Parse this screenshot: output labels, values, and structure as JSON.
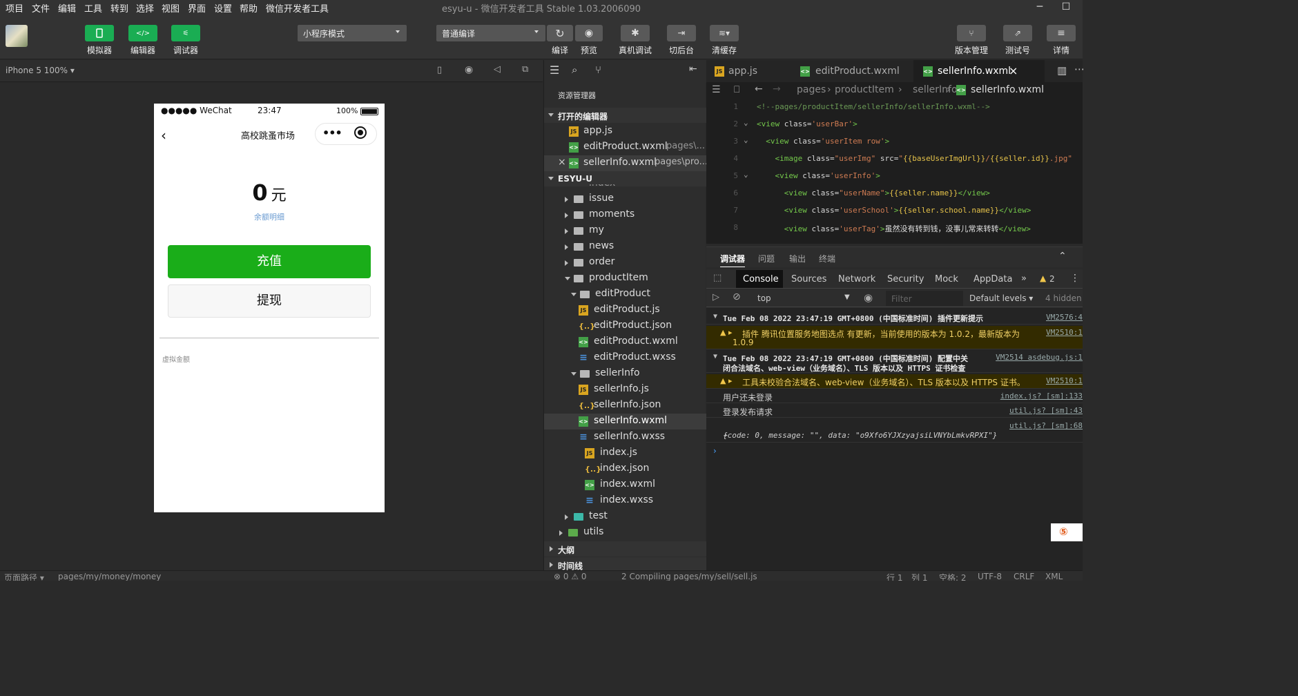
{
  "menu": [
    "项目",
    "文件",
    "编辑",
    "工具",
    "转到",
    "选择",
    "视图",
    "界面",
    "设置",
    "帮助",
    "微信开发者工具"
  ],
  "window_title": "esyu-u - 微信开发者工具 Stable 1.03.2006090",
  "toolbar": {
    "simulator": "模拟器",
    "editor": "编辑器",
    "debugger": "调试器",
    "mode_select": "小程序模式",
    "compile_select": "普通编译",
    "compile": "编译",
    "preview": "预览",
    "real_debug": "真机调试",
    "switch_bg": "切后台",
    "clear_cache": "清缓存",
    "version": "版本管理",
    "test_account": "测试号",
    "details": "详情"
  },
  "sim": {
    "device": "iPhone 5 100% ▾",
    "status_carrier": "●●●●● WeChat",
    "status_time": "23:47",
    "status_battery": "100%",
    "nav_title": "高校跳蚤市场",
    "balance_value": "0",
    "balance_unit": "元",
    "balance_link": "余额明细",
    "recharge_btn": "充值",
    "withdraw_btn": "提现",
    "virtual_amount": "虚拟金额"
  },
  "explorer": {
    "title": "资源管理器",
    "open_editors": "打开的编辑器",
    "open_files": [
      {
        "name": "app.js",
        "path": "",
        "type": "js"
      },
      {
        "name": "editProduct.wxml",
        "path": "pages\\...",
        "type": "wxml"
      },
      {
        "name": "sellerInfo.wxml",
        "path": "pages\\pro...",
        "type": "wxml"
      }
    ],
    "project": "ESYU-U",
    "partial": "index",
    "outline": "大纲",
    "timeline": "时间线"
  },
  "tree": [
    {
      "name": "issue",
      "type": "folder",
      "depth": 0,
      "exp": "r"
    },
    {
      "name": "moments",
      "type": "folder",
      "depth": 0,
      "exp": "r"
    },
    {
      "name": "my",
      "type": "folder",
      "depth": 0,
      "exp": "r"
    },
    {
      "name": "news",
      "type": "folder",
      "depth": 0,
      "exp": "r"
    },
    {
      "name": "order",
      "type": "folder",
      "depth": 0,
      "exp": "r"
    },
    {
      "name": "productItem",
      "type": "folder",
      "depth": 0,
      "exp": "d"
    },
    {
      "name": "editProduct",
      "type": "folder",
      "depth": 1,
      "exp": "d"
    },
    {
      "name": "editProduct.js",
      "type": "js",
      "depth": 2
    },
    {
      "name": "editProduct.json",
      "type": "json",
      "depth": 2
    },
    {
      "name": "editProduct.wxml",
      "type": "wxml",
      "depth": 2
    },
    {
      "name": "editProduct.wxss",
      "type": "wxss",
      "depth": 2
    },
    {
      "name": "sellerInfo",
      "type": "folder",
      "depth": 1,
      "exp": "d"
    },
    {
      "name": "sellerInfo.js",
      "type": "js",
      "depth": 2
    },
    {
      "name": "sellerInfo.json",
      "type": "json",
      "depth": 2
    },
    {
      "name": "sellerInfo.wxml",
      "type": "wxml",
      "depth": 2,
      "sel": true
    },
    {
      "name": "sellerInfo.wxss",
      "type": "wxss",
      "depth": 2
    },
    {
      "name": "index.js",
      "type": "js",
      "depth": 1
    },
    {
      "name": "index.json",
      "type": "json",
      "depth": 1
    },
    {
      "name": "index.wxml",
      "type": "wxml",
      "depth": 1
    },
    {
      "name": "index.wxss",
      "type": "wxss",
      "depth": 1
    },
    {
      "name": "test",
      "type": "folder-teal",
      "depth": 0,
      "exp": "r"
    },
    {
      "name": "utils",
      "type": "folder-green",
      "depth": -1,
      "exp": "r"
    }
  ],
  "editor": {
    "tabs": [
      "app.js",
      "editProduct.wxml",
      "sellerInfo.wxml"
    ],
    "breadcrumb": [
      "pages",
      "productItem",
      "sellerInfo",
      "sellerInfo.wxml"
    ],
    "lines": [
      {
        "n": "1",
        "html": "<span class='cm'>&lt;!--pages/productItem/sellerInfo/sellerInfo.wxml--&gt;</span>"
      },
      {
        "n": "2",
        "html": "<span class='tg'>&lt;view</span> <span class='at'>class=</span><span class='sv'>'userBar'</span><span class='tg'>&gt;</span>"
      },
      {
        "n": "3",
        "html": "&nbsp;&nbsp;<span class='tg'>&lt;view</span> <span class='at'>class=</span><span class='sv'>'userItem row'</span><span class='tg'>&gt;</span>"
      },
      {
        "n": "4",
        "html": "&nbsp;&nbsp;&nbsp;&nbsp;<span class='tg'>&lt;image</span> <span class='at'>class=</span><span class='sv'>\"userImg\"</span> <span class='at'>src=</span><span class='sv'>\"</span><span class='ex'>{{baseUserImgUrl}}</span><span class='sv'>/</span><span class='ex'>{{seller.id}}</span><span class='sv'>.jpg\"</span>"
      },
      {
        "n": "5",
        "html": "&nbsp;&nbsp;&nbsp;&nbsp;<span class='tg'>&lt;view</span> <span class='at'>class=</span><span class='sv'>'userInfo'</span><span class='tg'>&gt;</span>"
      },
      {
        "n": "6",
        "html": "&nbsp;&nbsp;&nbsp;&nbsp;&nbsp;&nbsp;<span class='tg'>&lt;view</span> <span class='at'>class=</span><span class='sv'>\"userName\"</span><span class='tg'>&gt;</span><span class='ex'>{{seller.name}}</span><span class='tg'>&lt;/view&gt;</span>"
      },
      {
        "n": "7",
        "html": "&nbsp;&nbsp;&nbsp;&nbsp;&nbsp;&nbsp;<span class='tg'>&lt;view</span> <span class='at'>class=</span><span class='sv'>'userSchool'</span><span class='tg'>&gt;</span><span class='ex'>{{seller.school.name}}</span><span class='tg'>&lt;/view&gt;</span>"
      },
      {
        "n": "8",
        "html": "&nbsp;&nbsp;&nbsp;&nbsp;&nbsp;&nbsp;<span class='tg'>&lt;view</span> <span class='at'>class=</span><span class='sv'>'userTag'</span><span class='tg'>&gt;</span>虽然没有转到钱，没事儿常来转转<span class='tg'>&lt;/view&gt;</span>"
      }
    ]
  },
  "devtools": {
    "tabs": [
      "调试器",
      "问题",
      "输出",
      "终端"
    ],
    "panels": [
      "Console",
      "Sources",
      "Network",
      "Security",
      "Mock",
      "AppData"
    ],
    "warn_count": "2",
    "context": "top",
    "filter_placeholder": "Filter",
    "levels": "Default levels ▾",
    "hidden": "4 hidden"
  },
  "console": [
    {
      "type": "group",
      "text": "Tue Feb 08 2022 23:47:19 GMT+0800 (中国标准时间) 插件更新提示",
      "src": "VM2576:4"
    },
    {
      "type": "warn",
      "text": "插件 腾讯位置服务地图选点 有更新，当前使用的版本为 1.0.2，最新版本为",
      "text2": "1.0.9",
      "src": "VM2510:1"
    },
    {
      "type": "group",
      "text": "Tue Feb 08 2022 23:47:19 GMT+0800 (中国标准时间) 配置中关",
      "text2": "闭合法域名、web-view（业务域名）、TLS 版本以及 HTTPS 证书检查",
      "src": "VM2514 asdebug.js:1"
    },
    {
      "type": "warn",
      "text": "工具未校验合法域名、web-view（业务域名）、TLS 版本以及 HTTPS 证书。",
      "src": "VM2510:1"
    },
    {
      "type": "log",
      "text": "用户还未登录",
      "src": "index.js? [sm]:133"
    },
    {
      "type": "log",
      "text": "登录发布请求",
      "src": "util.js? [sm]:43"
    },
    {
      "type": "obj",
      "text": "{code: 0, message: \"\", data: \"o9Xfo6YJXzyajsiLVNYbLmkvRPXI\"}",
      "src": "util.js? [sm]:68"
    }
  ],
  "status": {
    "page_path_label": "页面路径 ▾",
    "page_path": "pages/my/money/money",
    "problems": "⊗ 0 ⚠ 0",
    "compiling": "2 Compiling pages/my/sell/sell.js",
    "row": "行 1",
    "col": "列 1",
    "spaces": "空格: 2",
    "encoding": "UTF-8",
    "eol": "CRLF",
    "lang": "XML"
  }
}
